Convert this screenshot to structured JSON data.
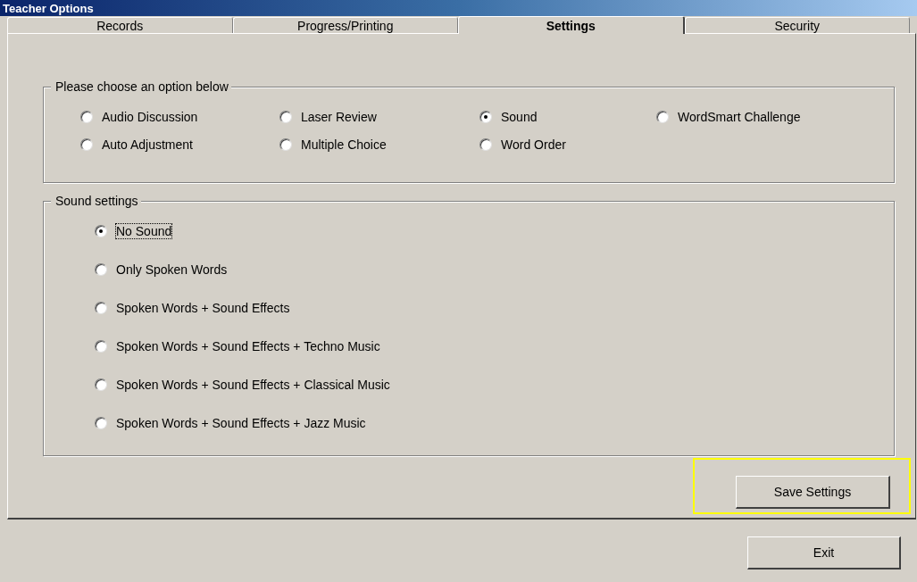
{
  "window": {
    "title": "Teacher Options"
  },
  "tabs": [
    {
      "label": "Records",
      "selected": false
    },
    {
      "label": "Progress/Printing",
      "selected": false
    },
    {
      "label": "Settings",
      "selected": true
    },
    {
      "label": "Security",
      "selected": false
    }
  ],
  "option_group": {
    "title": "Please choose an option below",
    "options": [
      {
        "label": "Audio Discussion",
        "selected": false
      },
      {
        "label": "Laser Review",
        "selected": false
      },
      {
        "label": "Sound",
        "selected": true
      },
      {
        "label": "WordSmart Challenge",
        "selected": false
      },
      {
        "label": "Auto Adjustment",
        "selected": false
      },
      {
        "label": "Multiple Choice",
        "selected": false
      },
      {
        "label": "Word Order",
        "selected": false
      }
    ]
  },
  "sound_group": {
    "title": "Sound settings",
    "options": [
      {
        "label": "No Sound",
        "selected": true
      },
      {
        "label": "Only Spoken Words",
        "selected": false
      },
      {
        "label": "Spoken Words + Sound Effects",
        "selected": false
      },
      {
        "label": "Spoken Words + Sound Effects + Techno Music",
        "selected": false
      },
      {
        "label": "Spoken Words + Sound Effects + Classical Music",
        "selected": false
      },
      {
        "label": "Spoken Words + Sound Effects + Jazz Music",
        "selected": false
      }
    ]
  },
  "save_button": {
    "label": "Save Settings",
    "highlighted": true
  },
  "exit_button": {
    "label": "Exit"
  }
}
